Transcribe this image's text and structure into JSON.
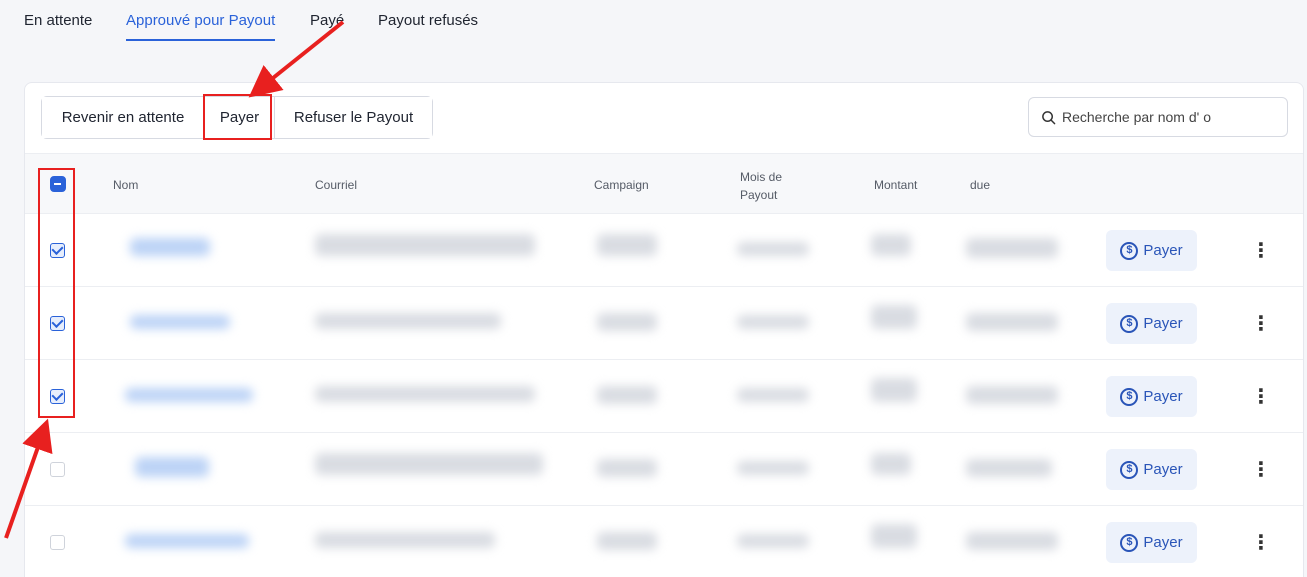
{
  "tabs": [
    {
      "label": "En attente",
      "active": false
    },
    {
      "label": "Approuvé pour Payout",
      "active": true
    },
    {
      "label": "Payé",
      "active": false
    },
    {
      "label": "Payout refusés",
      "active": false
    }
  ],
  "toolbar": {
    "revert_label": "Revenir en attente",
    "pay_label": "Payer",
    "refuse_label": "Refuser le Payout"
  },
  "search": {
    "placeholder": "Recherche par nom d' o"
  },
  "table": {
    "columns": {
      "name": "Nom",
      "email": "Courriel",
      "campaign": "Campaign",
      "month": "Mois de Payout",
      "amount": "Montant",
      "due": "due"
    },
    "header_checkbox_state": "indeterminate",
    "rows": [
      {
        "checked": true,
        "pay_label": "Payer"
      },
      {
        "checked": true,
        "pay_label": "Payer"
      },
      {
        "checked": true,
        "pay_label": "Payer"
      },
      {
        "checked": false,
        "pay_label": "Payer"
      },
      {
        "checked": false,
        "pay_label": "Payer"
      }
    ]
  },
  "colors": {
    "accent": "#2a62d9",
    "annotation": "#e8201f",
    "pay_button_bg": "#edf2fb"
  },
  "icons": {
    "search": "search-icon",
    "pay": "dollar-circle-icon",
    "more": "more-vertical-icon"
  }
}
